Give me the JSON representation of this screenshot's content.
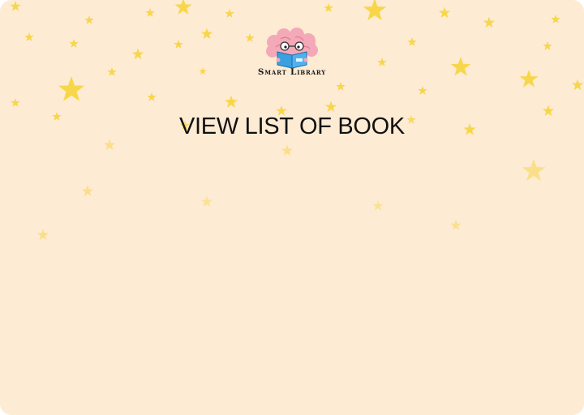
{
  "app": {
    "brand_name": "Smart Library"
  },
  "main": {
    "title": "VIEW LIST OF BOOK"
  },
  "theme": {
    "background": "#fdebd3",
    "star_color": "#f7d64a",
    "logo_brain_color": "#f4a9b8",
    "logo_book_color": "#3aa0e0"
  },
  "icons": {
    "logo": "brain-reading-book-icon",
    "decoration": "star-icon"
  }
}
